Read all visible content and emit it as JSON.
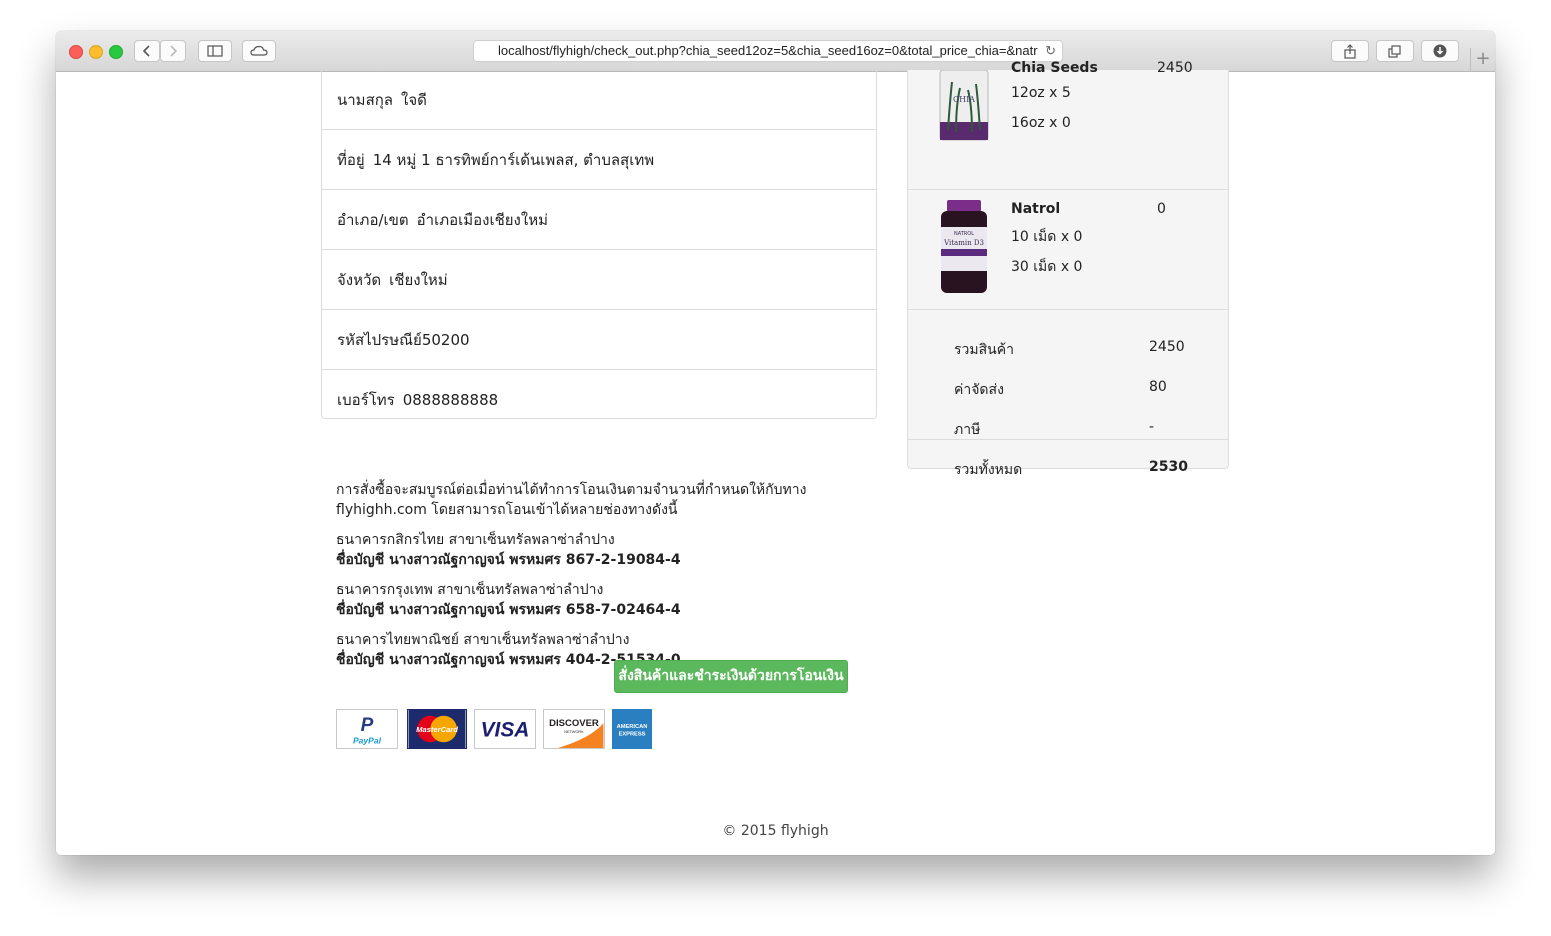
{
  "browser": {
    "url": "localhost/flyhigh/check_out.php?chia_seed12oz=5&chia_seed16oz=0&total_price_chia=&natr"
  },
  "address": {
    "rows": [
      {
        "label": "นามสกุล",
        "value": "ใจดี"
      },
      {
        "label": "ที่อยู่",
        "value": "14 หมู่ 1 ธารทิพย์การ์เด้นเพลส, ตำบลสุเทพ"
      },
      {
        "label": "อำเภอ/เขต",
        "value": "อำเภอเมืองเชียงใหม่"
      },
      {
        "label": "จังหวัด",
        "value": "เชียงใหม่"
      },
      {
        "label": "รหัสไปรษณีย์",
        "value": "50200"
      },
      {
        "label": "เบอร์โทร",
        "value": "0888888888"
      }
    ]
  },
  "cart": {
    "products": [
      {
        "name": "Chia Seeds",
        "price": "2450",
        "options": [
          "12oz x 5",
          "16oz x 0"
        ]
      },
      {
        "name": "Natrol",
        "price": "0",
        "options": [
          "10 เม็ด x 0",
          "30 เม็ด x 0"
        ]
      }
    ],
    "subtotal_label": "รวมสินค้า",
    "subtotal": "2450",
    "shipping_label": "ค่าจัดส่ง",
    "shipping": "80",
    "tax_label": "ภาษี",
    "tax": "-",
    "total_label": "รวมทั้งหมด",
    "total": "2530"
  },
  "payment_notice": {
    "intro": "การสั่งซื้อจะสมบูรณ์ต่อเมื่อท่านได้ทำการโอนเงินตามจำนวนที่กำหนดให้กับทาง flyhighh.com โดยสามารถโอนเข้าได้หลายช่องทางดังนี้",
    "banks": [
      {
        "bank": "ธนาคารกสิกรไทย สาขาเซ็นทรัลพลาซ่าลำปาง",
        "account": "ชื่อบัญชี นางสาวณัฐกาญจน์ พรหมศร 867-2-19084-4"
      },
      {
        "bank": "ธนาคารกรุงเทพ สาขาเซ็นทรัลพลาซ่าลำปาง",
        "account": "ชื่อบัญชี นางสาวณัฐกาญจน์ พรหมศร 658-7-02464-4"
      },
      {
        "bank": "ธนาคารไทยพาณิชย์ สาขาเซ็นทรัลพลาซ่าลำปาง",
        "account": "ชื่อบัญชี นางสาวณัฐกาญจน์ พรหมศร 404-2-51534-0"
      }
    ]
  },
  "order_button": "สั่งสินค้าและชำระเงินด้วยการโอนเงิน",
  "payment_logos": {
    "paypal": "PayPal",
    "mastercard": "MasterCard",
    "visa": "VISA",
    "discover": "DISCOVER",
    "discover_sub": "NETWORK",
    "amex_line1": "AMERICAN",
    "amex_line2": "EXPRESS"
  },
  "product_images": {
    "chia_brand": "CHIA",
    "natrol_brand": "NATROL",
    "natrol_product": "Vitamin D3"
  },
  "footer": "©  2015  flyhigh",
  "colors": {
    "success_button": "#5cb85c",
    "panel_bg": "#f5f5f5",
    "border": "#dcdcdc"
  }
}
